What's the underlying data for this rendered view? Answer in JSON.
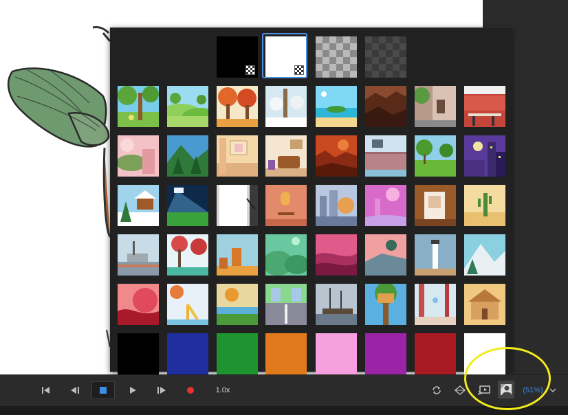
{
  "toolbar": {
    "speed_label": "1.0x",
    "zoom_label": "(51%)",
    "accent_color": "#3d8ee6",
    "record_color": "#e5322b",
    "icons": [
      "skip-to-start-icon",
      "step-back-icon",
      "stop-icon",
      "play-icon",
      "step-forward-icon",
      "record-icon",
      "loop-icon",
      "onion-skin-icon",
      "cast-icon",
      "background-picker-icon",
      "chevron-down-icon"
    ]
  },
  "background_picker": {
    "selected": "white-checker",
    "special_tiles": [
      "black-with-checker",
      "white-with-checker",
      "transparent-light",
      "transparent-dark"
    ],
    "scene_tiles": [
      [
        "park-trees",
        "green-hills",
        "autumn-forest",
        "winter-forest",
        "tropical-beach",
        "rocky-canyon",
        "town-street",
        "cafe-interior"
      ],
      [
        "pink-garden",
        "mountain-pines",
        "empty-room",
        "living-room",
        "orange-desert-canyon",
        "lab-room",
        "park-lake",
        "night-city"
      ],
      [
        "snowy-cabin",
        "stadium-lights",
        "photo-studio",
        "cozy-room",
        "city-skyline",
        "pink-castle",
        "wooden-door",
        "cactus-desert"
      ],
      [
        "ship-harbor",
        "autumn-trees",
        "mesa-rocks",
        "green-mounds",
        "pink-dunes",
        "sunset-coast",
        "lighthouse",
        "snowy-mountains"
      ],
      [
        "red-leaves",
        "playground",
        "farm-landscape",
        "road-crossing",
        "ship-dock",
        "treehouse",
        "fairy-forest",
        "house-yard"
      ]
    ],
    "color_tiles": [
      "#000000",
      "#1f2fa0",
      "#1d9430",
      "#e07a1c",
      "#f7a0df",
      "#9a24a5",
      "#a81b22",
      "#ffffff"
    ]
  }
}
